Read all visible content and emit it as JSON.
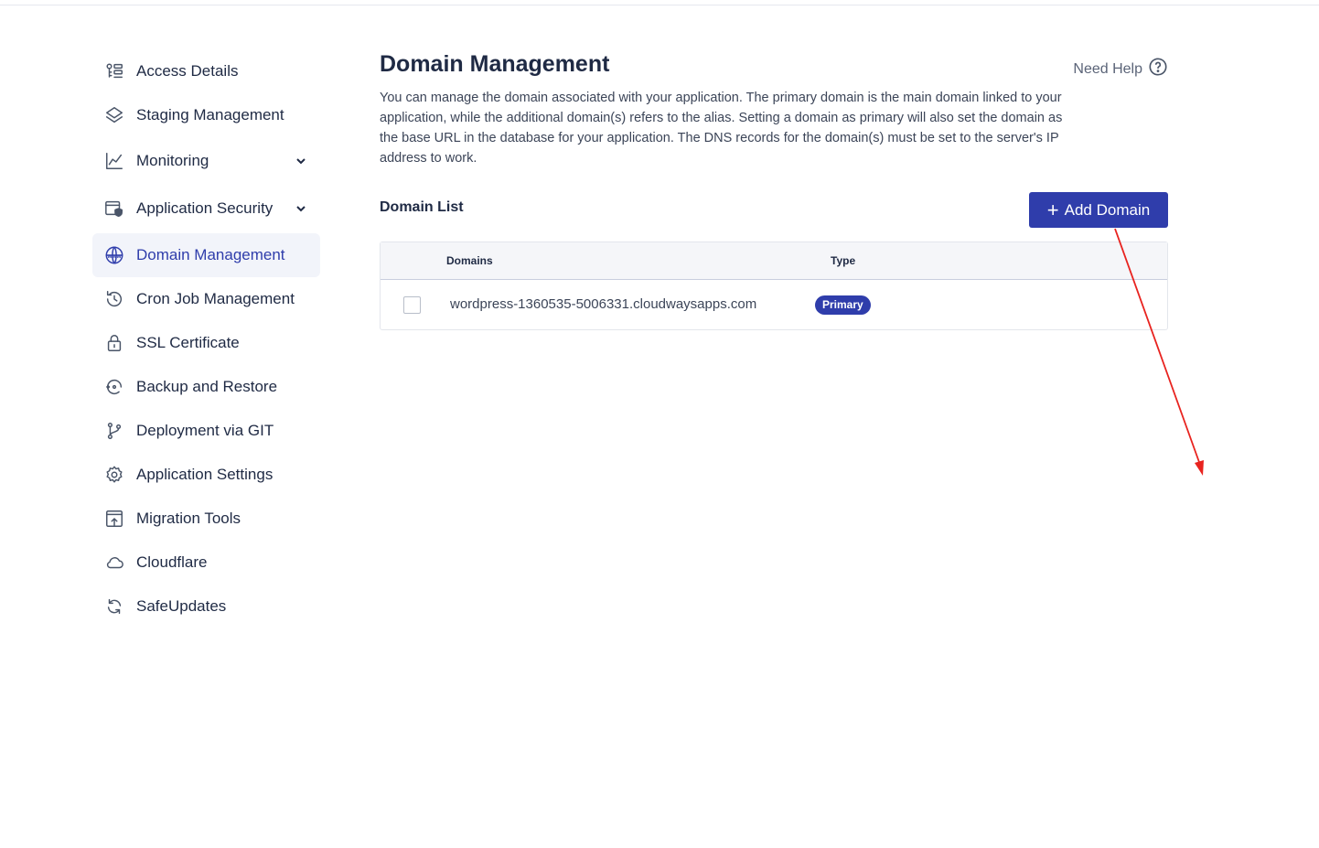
{
  "sidebar": {
    "items": [
      {
        "label": "Access Details",
        "icon": "key-list-icon"
      },
      {
        "label": "Staging Management",
        "icon": "layers-icon"
      },
      {
        "label": "Monitoring",
        "icon": "chart-line-icon"
      },
      {
        "label": "Application Security",
        "icon": "shield-window-icon"
      },
      {
        "label": "Domain Management",
        "icon": "www-globe-icon"
      },
      {
        "label": "Cron Job Management",
        "icon": "history-clock-icon"
      },
      {
        "label": "SSL Certificate",
        "icon": "lock-icon"
      },
      {
        "label": "Backup and Restore",
        "icon": "restore-icon"
      },
      {
        "label": "Deployment via GIT",
        "icon": "git-branch-icon"
      },
      {
        "label": "Application Settings",
        "icon": "gear-icon"
      },
      {
        "label": "Migration Tools",
        "icon": "upload-window-icon"
      },
      {
        "label": "Cloudflare",
        "icon": "cloud-icon"
      },
      {
        "label": "SafeUpdates",
        "icon": "refresh-icon"
      }
    ],
    "active": "Domain Management"
  },
  "main": {
    "title": "Domain Management",
    "need_help": "Need Help",
    "description": "You can manage the domain associated with your application. The primary domain is the main domain linked to your application, while the additional domain(s) refers to the alias. Setting a domain as primary will also set the domain as the base URL in the database for your application. The DNS records for the domain(s) must be set to the server's IP address to work.",
    "list_title": "Domain List",
    "add_button": "Add Domain",
    "table": {
      "headers": {
        "domains": "Domains",
        "type": "Type"
      },
      "rows": [
        {
          "domain": "wordpress-1360535-5006331.cloudwaysapps.com",
          "type": "Primary"
        }
      ]
    }
  },
  "colors": {
    "accent": "#2f3dab",
    "annotation_arrow": "#e8231f"
  }
}
